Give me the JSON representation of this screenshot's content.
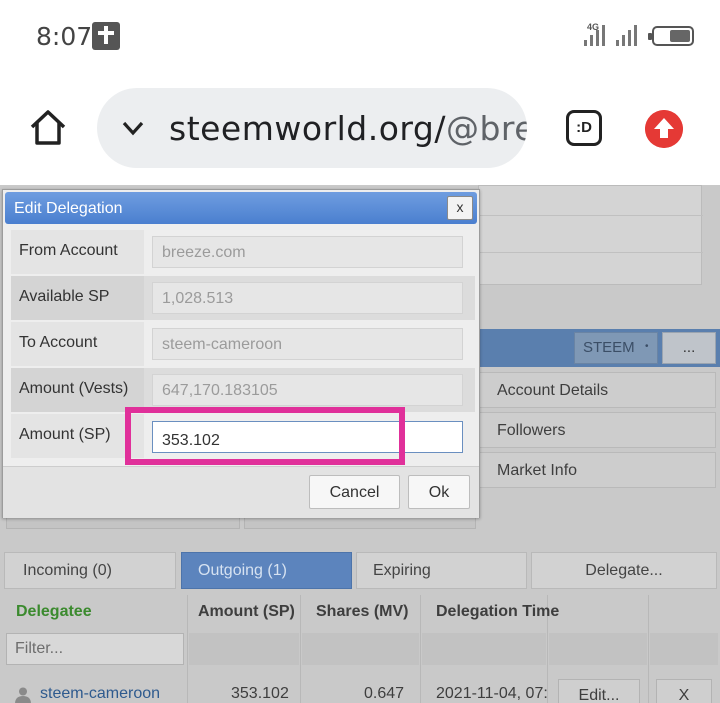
{
  "status_bar": {
    "time": "8:07",
    "network": "4G"
  },
  "browser": {
    "url_host": "steemworld.org/",
    "url_path": "@breez",
    "extension_label": ":D"
  },
  "dialog": {
    "title": "Edit Delegation",
    "close_label": "x",
    "fields": [
      {
        "label": "From Account",
        "value": "breeze.com"
      },
      {
        "label": "Available SP",
        "value": "1,028.513"
      },
      {
        "label": "To Account",
        "value": "steem-cameroon"
      },
      {
        "label": "Amount (Vests)",
        "value": "647,170.183105"
      },
      {
        "label": "Amount (SP)",
        "value": "353.102"
      }
    ],
    "cancel_label": "Cancel",
    "ok_label": "Ok"
  },
  "header": {
    "currency_select": "STEEM",
    "more_label": "..."
  },
  "side_menu": [
    "Account Details",
    "Followers",
    "Market Info"
  ],
  "tabs": [
    {
      "label": "Incoming (0)",
      "active": false
    },
    {
      "label": "Outgoing (1)",
      "active": true
    },
    {
      "label": "Expiring",
      "active": false
    },
    {
      "label": "Delegate...",
      "active": false
    }
  ],
  "table": {
    "columns": [
      "Delegatee",
      "Amount (SP)",
      "Shares (MV)",
      "Delegation Time"
    ],
    "filter_placeholder": "Filter...",
    "rows": [
      {
        "delegatee": "steem-cameroon",
        "amount_sp": "353.102",
        "shares_mv": "0.647",
        "time": "2021-11-04, 07:",
        "edit_label": "Edit...",
        "remove_label": "X"
      }
    ]
  },
  "colors": {
    "highlight": "#e0309a",
    "title_bar": "#4a7fcf",
    "active_tab": "#5c84bd",
    "upload_button": "#e53935"
  }
}
